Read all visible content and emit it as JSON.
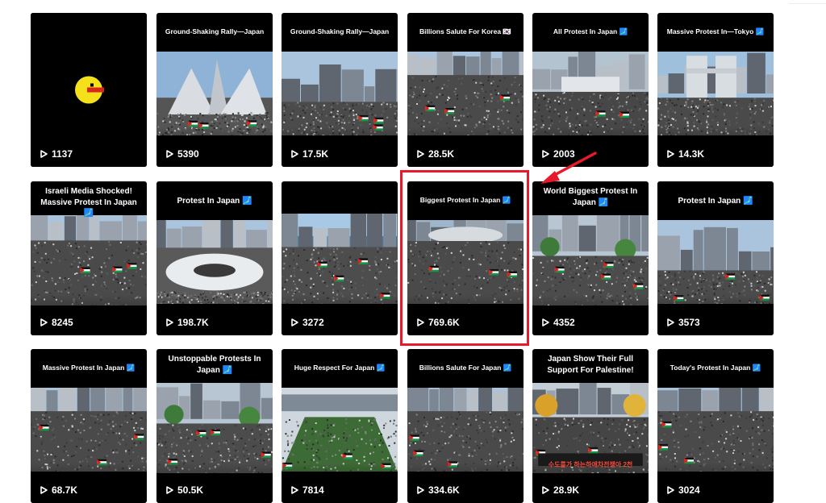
{
  "colors": {
    "annotation_red": "#e8192a",
    "card_bg": "#000000",
    "text": "#ffffff"
  },
  "icons": {
    "views": "play-icon"
  },
  "videos": [
    {
      "title": "",
      "views": "1137",
      "thumb": "pacman"
    },
    {
      "title": "Ground-Shaking Rally—Japan",
      "views": "5390",
      "thumb": "building"
    },
    {
      "title": "Ground-Shaking Rally—Japan",
      "views": "17.5K",
      "thumb": "towers"
    },
    {
      "title": "Billions Salute For Korea 🇰🇷",
      "views": "28.5K",
      "thumb": "crowd"
    },
    {
      "title": "All Protest In Japan 🗾",
      "views": "2003",
      "thumb": "plaza"
    },
    {
      "title": "Massive Protest In—Tokyo 🗾",
      "views": "14.3K",
      "thumb": "tokyo"
    },
    {
      "title": "Israeli Media Shocked! Massive Protest In Japan 🗾",
      "views": "8245",
      "thumb": "crowd"
    },
    {
      "title": "Protest In Japan 🗾",
      "views": "198.7K",
      "thumb": "ring"
    },
    {
      "title": "",
      "views": "3272",
      "thumb": "sea"
    },
    {
      "title": "Biggest Protest In Japan 🗾",
      "views": "769.6K",
      "thumb": "stadium"
    },
    {
      "title": "World Biggest Protest In Japan 🗾",
      "views": "4352",
      "thumb": "trees"
    },
    {
      "title": "Protest In Japan 🗾",
      "views": "3573",
      "thumb": "towers"
    },
    {
      "title": "Massive Protest In Japan 🗾",
      "views": "68.7K",
      "thumb": "crowd"
    },
    {
      "title": "Unstoppable Protests In Japan 🗾",
      "views": "50.5K",
      "thumb": "trees"
    },
    {
      "title": "Huge Respect For Japan 🗾",
      "views": "7814",
      "thumb": "field"
    },
    {
      "title": "Billions Salute For Japan 🗾",
      "views": "334.6K",
      "thumb": "crowd"
    },
    {
      "title": "Japan Show Their Full Support For Palestine!",
      "views": "28.9K",
      "thumb": "autumn",
      "caption": "수도를가 하는하애차전쟁아 2천"
    },
    {
      "title": "Today's Protest In Japan 🗾",
      "views": "3024",
      "thumb": "crowd"
    }
  ]
}
